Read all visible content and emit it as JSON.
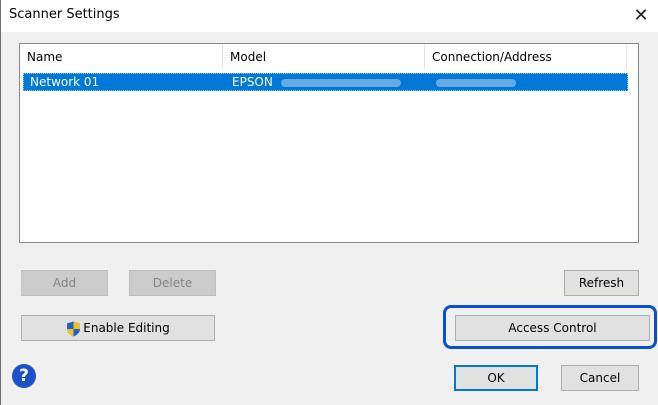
{
  "window": {
    "title": "Scanner Settings",
    "close_icon": "close-icon"
  },
  "table": {
    "columns": [
      "Name",
      "Model",
      "Connection/Address"
    ],
    "rows": [
      {
        "name": "Network 01",
        "model": "EPSON",
        "model_obscured": "blurred",
        "address_obscured": "blurred"
      }
    ]
  },
  "buttons": {
    "add": "Add",
    "delete": "Delete",
    "refresh": "Refresh",
    "enable_editing": "Enable Editing",
    "access_control": "Access Control",
    "ok": "OK",
    "cancel": "Cancel"
  },
  "icons": {
    "help": "help-icon",
    "shield": "shield-icon"
  },
  "colors": {
    "selection": "#0078d7",
    "highlight": "#0a4fd0",
    "help": "#1e50c8"
  }
}
